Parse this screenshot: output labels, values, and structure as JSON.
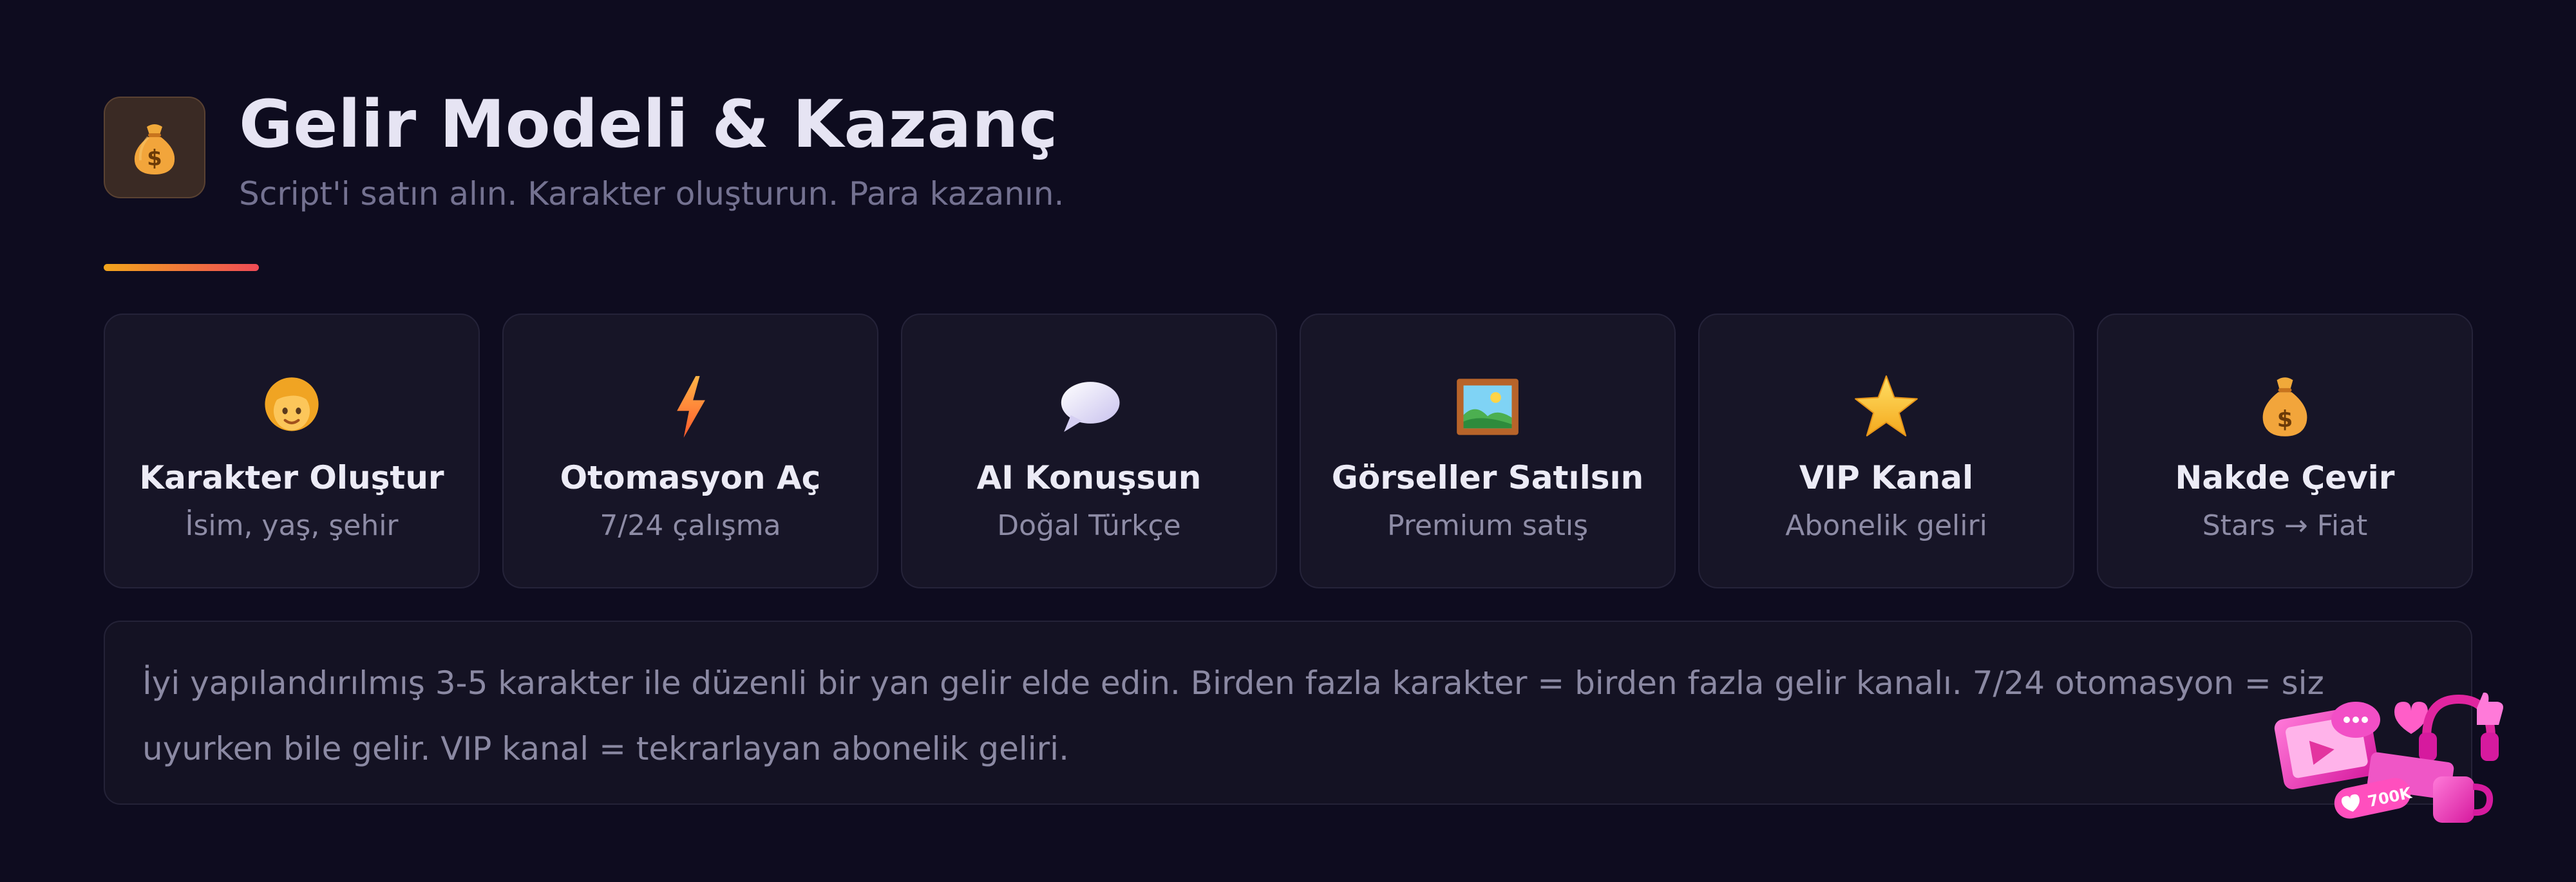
{
  "header": {
    "icon": "money-bag-icon",
    "title": "Gelir Modeli & Kazanç",
    "subtitle": "Script'i satın alın. Karakter oluşturun. Para kazanın."
  },
  "colors": {
    "background": "#0e0c1f",
    "card_background": "#171527",
    "accent_start": "#f2a51c",
    "accent_end": "#ef4b56",
    "text_primary": "#e6e4f3",
    "text_muted": "#8b89a3"
  },
  "cards": [
    {
      "icon": "woman-face-icon",
      "title": "Karakter Oluştur",
      "subtitle": "İsim, yaş, şehir"
    },
    {
      "icon": "lightning-icon",
      "title": "Otomasyon Aç",
      "subtitle": "7/24 çalışma"
    },
    {
      "icon": "speech-bubble-icon",
      "title": "AI Konuşsun",
      "subtitle": "Doğal Türkçe"
    },
    {
      "icon": "framed-picture-icon",
      "title": "Görseller Satılsın",
      "subtitle": "Premium satış"
    },
    {
      "icon": "star-icon",
      "title": "VIP Kanal",
      "subtitle": "Abonelik geliri"
    },
    {
      "icon": "money-bag-icon",
      "title": "Nakde Çevir",
      "subtitle": "Stars → Fiat"
    }
  ],
  "note": {
    "text": "İyi yapılandırılmış 3-5 karakter ile düzenli bir yan gelir elde edin. Birden fazla karakter = birden fazla gelir kanalı. 7/24 otomasyon = siz uyurken bile gelir. VIP kanal = tekrarlayan abonelik geliri."
  },
  "sticker": {
    "icon": "social-media-sticker-icon",
    "badge": "700K"
  }
}
